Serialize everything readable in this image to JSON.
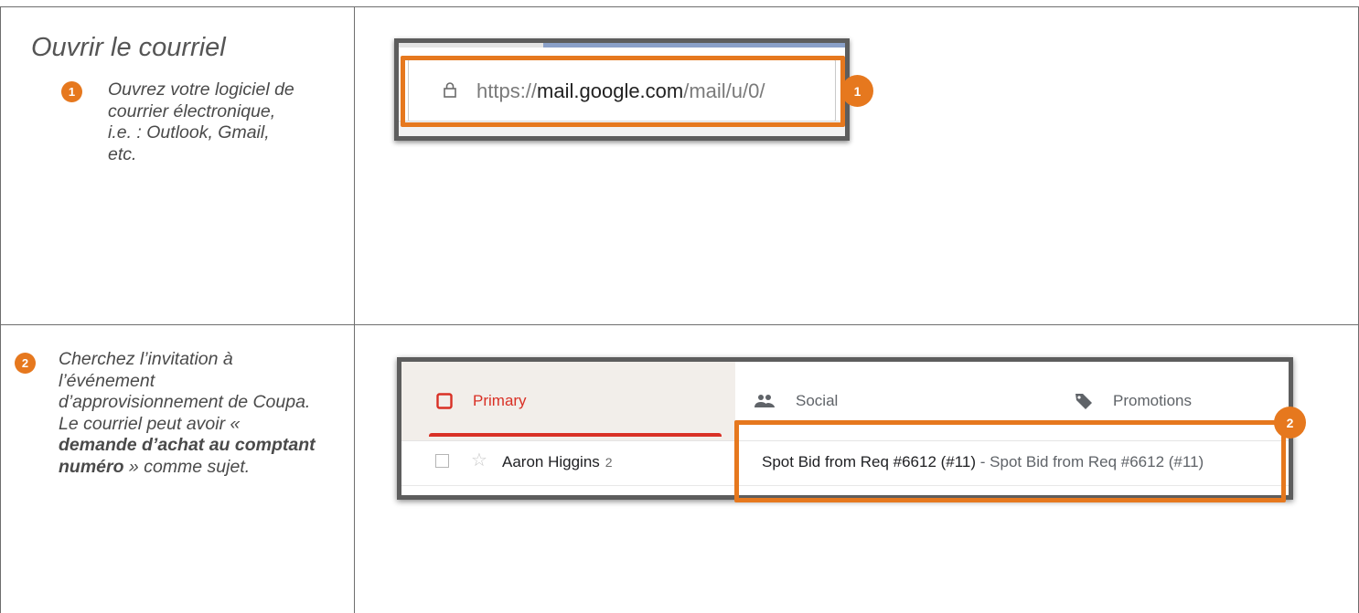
{
  "section": {
    "title": "Ouvrir le courriel"
  },
  "steps": [
    {
      "number": "1",
      "text": "Ouvrez votre logiciel de courrier électronique, i.e. : Outlook, Gmail, etc."
    },
    {
      "number": "2",
      "text_part1": "Cherchez l’invitation à l’événement d’approvisionnement de Coupa. Le courriel peut avoir « ",
      "text_bold": "demande d’achat au comptant numéro",
      "text_part2": " » comme sujet."
    }
  ],
  "screenshot_browser": {
    "url_scheme": "https://",
    "url_host": "mail.google.com",
    "url_path": "/mail/u/0/",
    "callout": "1",
    "icons": [
      "lock-icon"
    ]
  },
  "screenshot_inbox": {
    "tabs": [
      {
        "label": "Primary",
        "icon": "inbox-icon"
      },
      {
        "label": "Social",
        "icon": "people-icon"
      },
      {
        "label": "Promotions",
        "icon": "tag-icon"
      }
    ],
    "row": {
      "sender": "Aaron Higgins",
      "count": "2",
      "subject": "Spot Bid from Req #6612 (#11)",
      "snippet": " - Spot Bid from Req #6612 (#11)"
    },
    "callout": "2"
  },
  "colors": {
    "accent_orange": "#e6781e",
    "gmail_red": "#d93025",
    "frame_gray": "#5d5d5d"
  }
}
